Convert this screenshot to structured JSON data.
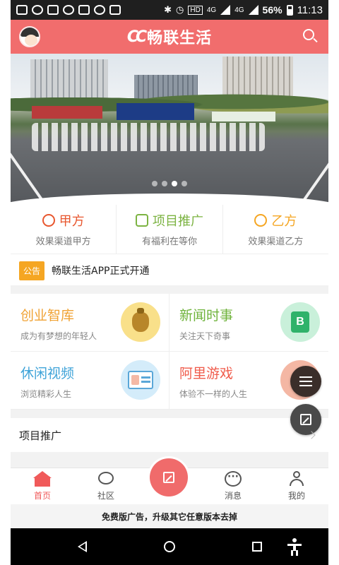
{
  "status_bar": {
    "net_label_1": "4G",
    "net_label_2": "4G",
    "battery": "56%",
    "time": "11:13"
  },
  "header": {
    "logo_mark": "CC",
    "title": "畅联生活"
  },
  "banner": {
    "slide_count": 4,
    "active_slide_index": 2
  },
  "quick": [
    {
      "title": "甲方",
      "subtitle": "效果渠道甲方",
      "icon": "compass-icon",
      "color": "#e8572f"
    },
    {
      "title": "项目推广",
      "subtitle": "有福利在等你",
      "icon": "route-icon",
      "color": "#7cb342"
    },
    {
      "title": "乙方",
      "subtitle": "效果渠道乙方",
      "icon": "smile-badge-icon",
      "color": "#f5a623"
    }
  ],
  "notice": {
    "tag": "公告",
    "text": "畅联生活APP正式开通"
  },
  "grid": [
    {
      "title": "创业智库",
      "subtitle": "成为有梦想的年轻人",
      "color": "#f0a233",
      "icon": "money-bag-icon",
      "icon_bg": "#f9e08a"
    },
    {
      "title": "新闻时事",
      "subtitle": "关注天下奇事",
      "color": "#6fb33b",
      "icon": "book-icon",
      "icon_bg": "#c9f0da",
      "icon_glyph": "B"
    },
    {
      "title": "休闲视频",
      "subtitle": "浏览精彩人生",
      "color": "#3ea3d8",
      "icon": "id-card-icon",
      "icon_bg": "#d4ecfa"
    },
    {
      "title": "阿里游戏",
      "subtitle": "体验不一样的人生",
      "color": "#f05b4b",
      "icon": "game-icon",
      "icon_bg": "#f4b7a4"
    }
  ],
  "project_row": {
    "label": "项目推广"
  },
  "tabs": [
    {
      "label": "首页",
      "icon": "home-icon",
      "active": true
    },
    {
      "label": "社区",
      "icon": "chat-bubble-icon",
      "active": false
    },
    {
      "label": "消息",
      "icon": "message-icon",
      "active": false
    },
    {
      "label": "我的",
      "icon": "user-icon",
      "active": false
    }
  ],
  "ad_bar": {
    "text": "免费版广告，升级其它任意版本去掉"
  },
  "colors": {
    "brand": "#f16d6d",
    "notice_tag": "#f5a623",
    "active_tab": "#f05a5a"
  }
}
